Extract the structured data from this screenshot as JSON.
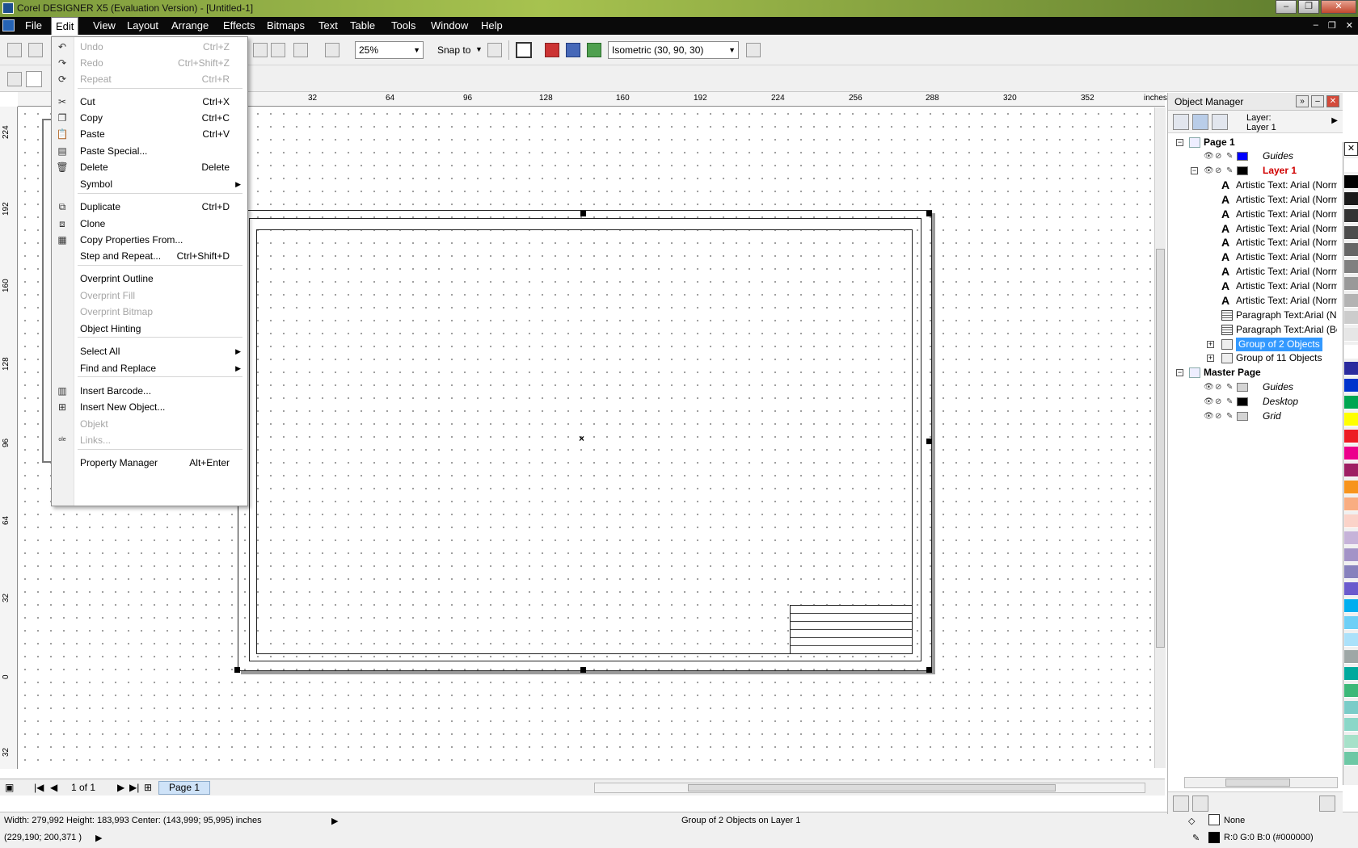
{
  "window": {
    "title": "Corel DESIGNER X5 (Evaluation Version) - [Untitled-1]"
  },
  "menubar": {
    "items": [
      {
        "label": "File"
      },
      {
        "label": "Edit"
      },
      {
        "label": "View"
      },
      {
        "label": "Layout"
      },
      {
        "label": "Arrange"
      },
      {
        "label": "Effects"
      },
      {
        "label": "Bitmaps"
      },
      {
        "label": "Text"
      },
      {
        "label": "Table"
      },
      {
        "label": "Tools"
      },
      {
        "label": "Window"
      },
      {
        "label": "Help"
      }
    ]
  },
  "toolbar": {
    "zoom": "25%",
    "snap_label": "Snap to",
    "projection": "Isometric (30, 90, 30)"
  },
  "ruler": {
    "unit": "inches",
    "h_ticks": [
      "32",
      "64",
      "96",
      "128",
      "160",
      "192",
      "224",
      "256",
      "288",
      "320",
      "352"
    ],
    "v_ticks": [
      "224",
      "192",
      "160",
      "128",
      "96",
      "64",
      "32",
      "0",
      "32"
    ]
  },
  "edit_menu": {
    "items": [
      {
        "label": "Undo",
        "shortcut": "Ctrl+Z",
        "icon": "undo-icon",
        "glyph": "↶"
      },
      {
        "label": "Redo",
        "shortcut": "Ctrl+Shift+Z",
        "icon": "redo-icon",
        "glyph": "↷"
      },
      {
        "label": "Repeat",
        "shortcut": "Ctrl+R",
        "icon": "repeat-icon",
        "glyph": "⟳"
      },
      {
        "label": "Cut",
        "shortcut": "Ctrl+X",
        "icon": "scissors-icon",
        "glyph": "✂"
      },
      {
        "label": "Copy",
        "shortcut": "Ctrl+C",
        "icon": "copy-icon",
        "glyph": "❐"
      },
      {
        "label": "Paste",
        "shortcut": "Ctrl+V",
        "icon": "paste-icon",
        "glyph": "📋"
      },
      {
        "label": "Paste Special...",
        "shortcut": "",
        "icon": "paste-special-icon",
        "glyph": "▤"
      },
      {
        "label": "Delete",
        "shortcut": "Delete",
        "icon": "trash-icon",
        "glyph": "🗑"
      },
      {
        "label": "Symbol",
        "shortcut": "",
        "icon": "",
        "glyph": ""
      },
      {
        "label": "Duplicate",
        "shortcut": "Ctrl+D",
        "icon": "duplicate-icon",
        "glyph": "⧉"
      },
      {
        "label": "Clone",
        "shortcut": "",
        "icon": "clone-icon",
        "glyph": "⧈"
      },
      {
        "label": "Copy Properties From...",
        "shortcut": "",
        "icon": "copy-properties-icon",
        "glyph": "▦"
      },
      {
        "label": "Step and Repeat...",
        "shortcut": "Ctrl+Shift+D",
        "icon": "",
        "glyph": ""
      },
      {
        "label": "Overprint Outline",
        "shortcut": "",
        "icon": "",
        "glyph": ""
      },
      {
        "label": "Overprint Fill",
        "shortcut": "",
        "icon": "",
        "glyph": ""
      },
      {
        "label": "Overprint Bitmap",
        "shortcut": "",
        "icon": "",
        "glyph": ""
      },
      {
        "label": "Object Hinting",
        "shortcut": "",
        "icon": "",
        "glyph": ""
      },
      {
        "label": "Select All",
        "shortcut": "",
        "icon": "",
        "glyph": ""
      },
      {
        "label": "Find and Replace",
        "shortcut": "",
        "icon": "",
        "glyph": ""
      },
      {
        "label": "Insert Barcode...",
        "shortcut": "",
        "icon": "barcode-icon",
        "glyph": "▥"
      },
      {
        "label": "Insert New Object...",
        "shortcut": "",
        "icon": "insert-object-icon",
        "glyph": "⊞"
      },
      {
        "label": "Objekt",
        "shortcut": "",
        "icon": "",
        "glyph": ""
      },
      {
        "label": "Links...",
        "shortcut": "",
        "icon": "links-icon",
        "glyph": "ole"
      },
      {
        "label": "Property Manager",
        "shortcut": "Alt+Enter",
        "icon": "",
        "glyph": ""
      }
    ]
  },
  "object_manager": {
    "title": "Object Manager",
    "layer_label": "Layer:",
    "layer_value": "Layer 1",
    "tree": [
      {
        "label": "Page 1",
        "kind": "page"
      },
      {
        "label": "Guides",
        "kind": "layer",
        "color": "#0000ff",
        "italic": true
      },
      {
        "label": "Layer 1",
        "kind": "layer-active",
        "color": "#000000"
      },
      {
        "label": "Artistic Text: Arial (Norm",
        "kind": "text"
      },
      {
        "label": "Artistic Text: Arial (Norm",
        "kind": "text"
      },
      {
        "label": "Artistic Text: Arial (Norm",
        "kind": "text"
      },
      {
        "label": "Artistic Text: Arial (Norm",
        "kind": "text"
      },
      {
        "label": "Artistic Text: Arial (Norm",
        "kind": "text"
      },
      {
        "label": "Artistic Text: Arial (Norm",
        "kind": "text"
      },
      {
        "label": "Artistic Text: Arial (Norm",
        "kind": "text"
      },
      {
        "label": "Artistic Text: Arial (Norm",
        "kind": "text"
      },
      {
        "label": "Artistic Text: Arial (Norm",
        "kind": "text"
      },
      {
        "label": "Paragraph Text:Arial (No",
        "kind": "para"
      },
      {
        "label": "Paragraph Text:Arial (Bol",
        "kind": "para"
      },
      {
        "label": "Group of 2 Objects",
        "kind": "group",
        "selected": true
      },
      {
        "label": "Group of 11 Objects",
        "kind": "group"
      },
      {
        "label": "Master Page",
        "kind": "page"
      },
      {
        "label": "Guides",
        "kind": "layer",
        "color": "#d4d4d4",
        "italic": true
      },
      {
        "label": "Desktop",
        "kind": "layer",
        "color": "#000000",
        "italic": true
      },
      {
        "label": "Grid",
        "kind": "layer",
        "color": "#d4d4d4",
        "italic": true
      }
    ]
  },
  "pagebar": {
    "page_count": "1 of 1",
    "page_tab": "Page 1"
  },
  "status": {
    "dimensions": "Width: 279,992  Height: 183,993  Center: (143,999; 95,995)  inches",
    "coords": "(229,190; 200,371 )",
    "selection": "Group of 2 Objects on Layer 1",
    "fill": "None",
    "outline": "R:0 G:0 B:0 (#000000)"
  },
  "colors": {
    "palette": [
      "#ffffff",
      "#000000",
      "#1a1a1a",
      "#333333",
      "#4d4d4d",
      "#666666",
      "#808080",
      "#999999",
      "#b3b3b3",
      "#cccccc",
      "#e6e6e6",
      "#ffffff",
      "#2b2b9e",
      "#0033cc",
      "#00a651",
      "#ffff00",
      "#ed1c24",
      "#ec008c",
      "#9e1f63",
      "#f7941d",
      "#f9ad81",
      "#fbd3c9",
      "#c6b3d9",
      "#a393c7",
      "#8781bd",
      "#6a5acd",
      "#00aeef",
      "#6dcff6",
      "#abe1fa",
      "#9ea7a6",
      "#00a99d",
      "#3cb878",
      "#7accc8",
      "#8ad7c8",
      "#a6e1c9",
      "#6dc8a5"
    ],
    "selection_highlight": "#3399ff"
  }
}
